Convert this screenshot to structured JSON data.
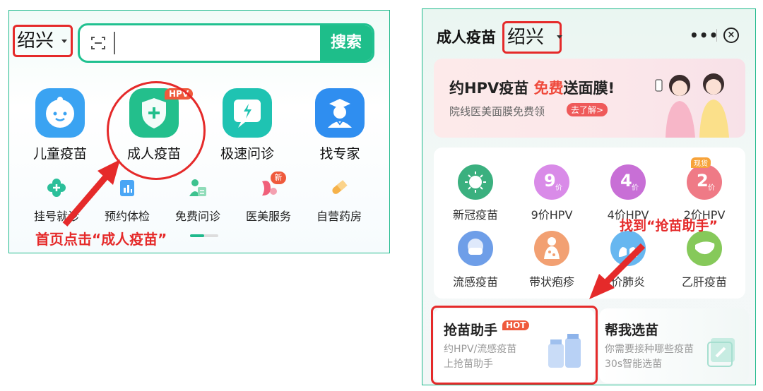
{
  "left_panel": {
    "city": "绍兴",
    "search_button": "搜索",
    "main_items": [
      {
        "label": "儿童疫苗",
        "icon": "baby-icon",
        "color": "#3aa3f2"
      },
      {
        "label": "成人疫苗",
        "icon": "shield-plus-icon",
        "color": "#23bf8c",
        "tag": "HPV"
      },
      {
        "label": "极速问诊",
        "icon": "lightning-chat-icon",
        "color": "#1fc3b2"
      },
      {
        "label": "找专家",
        "icon": "doctor-icon",
        "color": "#2f8ef0"
      }
    ],
    "sub_items": [
      {
        "label": "挂号就诊",
        "icon": "clover-cross-icon"
      },
      {
        "label": "预约体检",
        "icon": "clipboard-chart-icon"
      },
      {
        "label": "免费问诊",
        "icon": "doctor-card-icon"
      },
      {
        "label": "医美服务",
        "icon": "beauty-icon",
        "tag": "新"
      },
      {
        "label": "自营药房",
        "icon": "pill-icon"
      }
    ],
    "annotation": "首页点击“成人疫苗”"
  },
  "right_panel": {
    "title": "成人疫苗",
    "city": "绍兴",
    "more_icon": "•••",
    "close_icon": "⊗",
    "banner": {
      "title_prefix": "约HPV疫苗 ",
      "title_highlight": "免费",
      "title_suffix": "送面膜!",
      "subtitle": "院线医美面膜免费领",
      "button": "去了解>"
    },
    "vaccines": [
      {
        "label": "新冠疫苗",
        "num": "",
        "color": "#3bb07f",
        "icon": "virus-icon"
      },
      {
        "label": "9价HPV",
        "num": "9",
        "unit": "价",
        "color": "#d98be8"
      },
      {
        "label": "4价HPV",
        "num": "4",
        "unit": "价",
        "color": "#c86fd6"
      },
      {
        "label": "2价HPV",
        "num": "2",
        "unit": "价",
        "color": "#ef7a86",
        "tag": "现货"
      },
      {
        "label": "流感疫苗",
        "num": "",
        "color": "#6e9ee8",
        "icon": "face-mask-icon"
      },
      {
        "label": "带状疱疹",
        "num": "",
        "color": "#f2a072",
        "icon": "body-icon"
      },
      {
        "label": "价肺炎",
        "num": "",
        "color": "#67b7f0",
        "icon": "lungs-icon"
      },
      {
        "label": "乙肝疫苗",
        "num": "",
        "color": "#86c95a",
        "icon": "liver-icon"
      }
    ],
    "annotation": "找到“抢苗助手”",
    "helper_card": {
      "title": "抢苗助手",
      "tag": "HOT",
      "line1": "约HPV/流感疫苗",
      "line2": "上抢苗助手"
    },
    "pick_card": {
      "title": "帮我选苗",
      "line1": "你需要接种哪些疫苗",
      "line2": "30s智能选苗"
    }
  }
}
